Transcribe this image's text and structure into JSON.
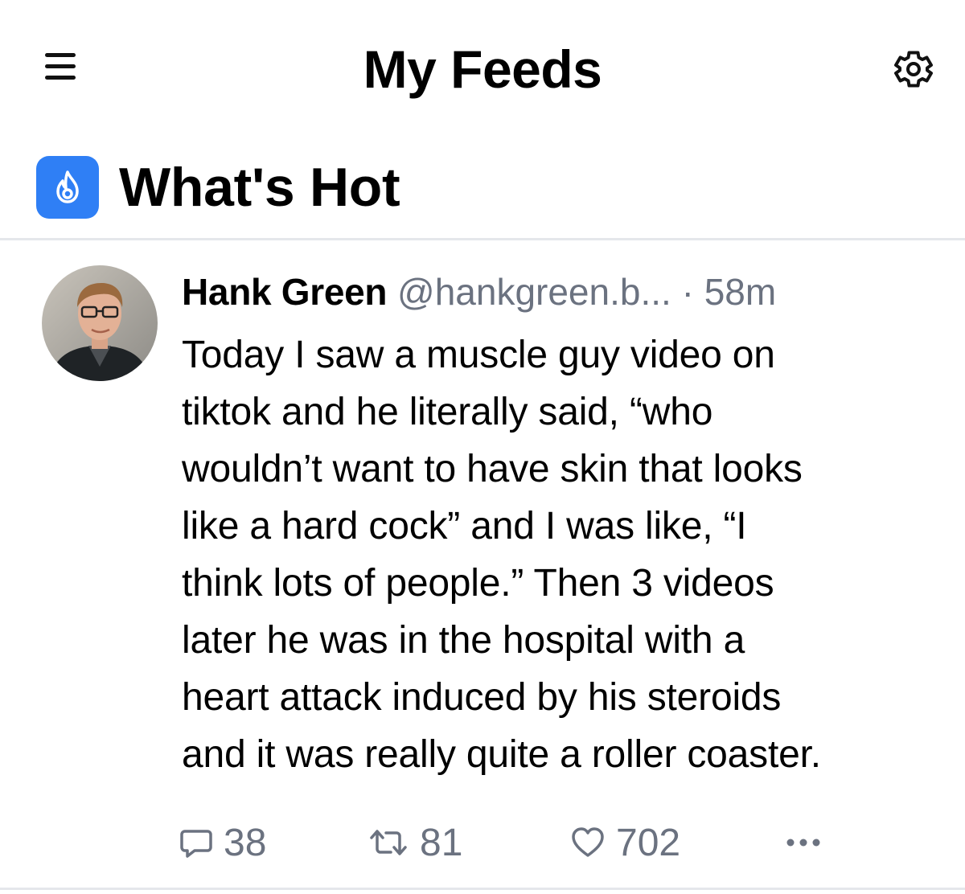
{
  "header": {
    "title": "My Feeds",
    "menu_icon": "hamburger-menu-icon",
    "settings_icon": "gear-icon"
  },
  "feed": {
    "title": "What's Hot",
    "icon": "flame-icon",
    "icon_color": "#2f7ff5"
  },
  "post": {
    "author": "Hank Green",
    "handle": "@hankgreen.b...",
    "separator": "·",
    "timestamp": "58m",
    "text_lines": [
      "Today I saw a muscle guy video on",
      "tiktok and he literally said, “who",
      "wouldn’t want to have skin that looks",
      "like a hard cock” and I was like, “I",
      "think lots of people.” Then 3 videos",
      "later he was in the hospital with a",
      "heart attack induced by his steroids",
      "and it was really quite a roller coaster."
    ],
    "replies": "38",
    "reposts": "81",
    "likes": "702"
  },
  "colors": {
    "muted": "#6b7280",
    "divider": "#e5e7eb",
    "accent": "#2f7ff5"
  }
}
